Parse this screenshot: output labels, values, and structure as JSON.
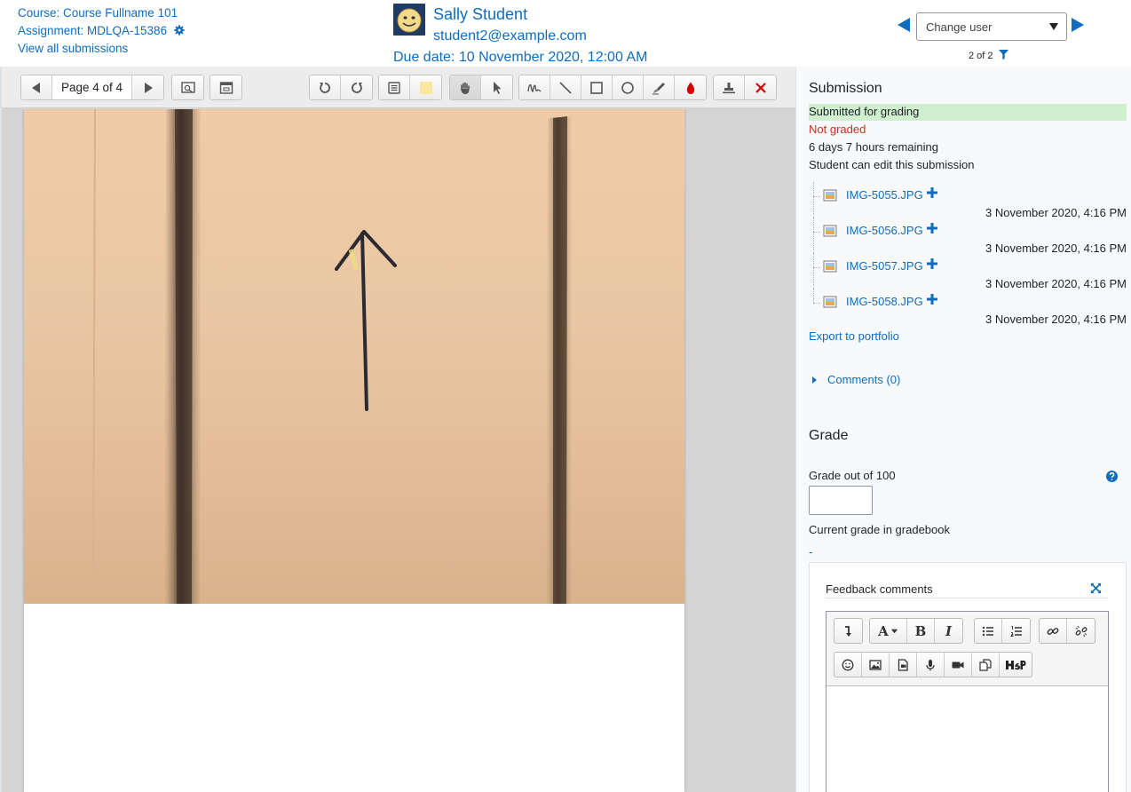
{
  "header": {
    "course_link": "Course: Course Fullname 101",
    "assignment_link": "Assignment: MDLQA-15386",
    "view_all_link": "View all submissions",
    "user_name": "Sally Student",
    "user_email": "student2@example.com",
    "due_date": "Due date: 10 November 2020, 12:00 AM",
    "change_user_placeholder": "Change user",
    "user_count": "2 of 2"
  },
  "toolbar": {
    "page_label": "Page 4 of 4"
  },
  "submission": {
    "title": "Submission",
    "status": "Submitted for grading",
    "grading_status": "Not graded",
    "time_remaining": "6 days 7 hours remaining",
    "edit_status": "Student can edit this submission",
    "files": [
      {
        "name": "IMG-5055.JPG",
        "date": "3 November 2020, 4:16 PM"
      },
      {
        "name": "IMG-5056.JPG",
        "date": "3 November 2020, 4:16 PM"
      },
      {
        "name": "IMG-5057.JPG",
        "date": "3 November 2020, 4:16 PM"
      },
      {
        "name": "IMG-5058.JPG",
        "date": "3 November 2020, 4:16 PM"
      }
    ],
    "export_link": "Export to portfolio",
    "comments_link": "Comments (0)"
  },
  "grade": {
    "title": "Grade",
    "grade_label": "Grade out of 100",
    "grade_value": "",
    "current_grade_label": "Current grade in gradebook",
    "current_grade_value": "-",
    "feedback_label": "Feedback comments"
  },
  "colors": {
    "link": "#0f6cbf",
    "submitted_bg": "#cfefcf",
    "not_graded": "#ca3120"
  }
}
